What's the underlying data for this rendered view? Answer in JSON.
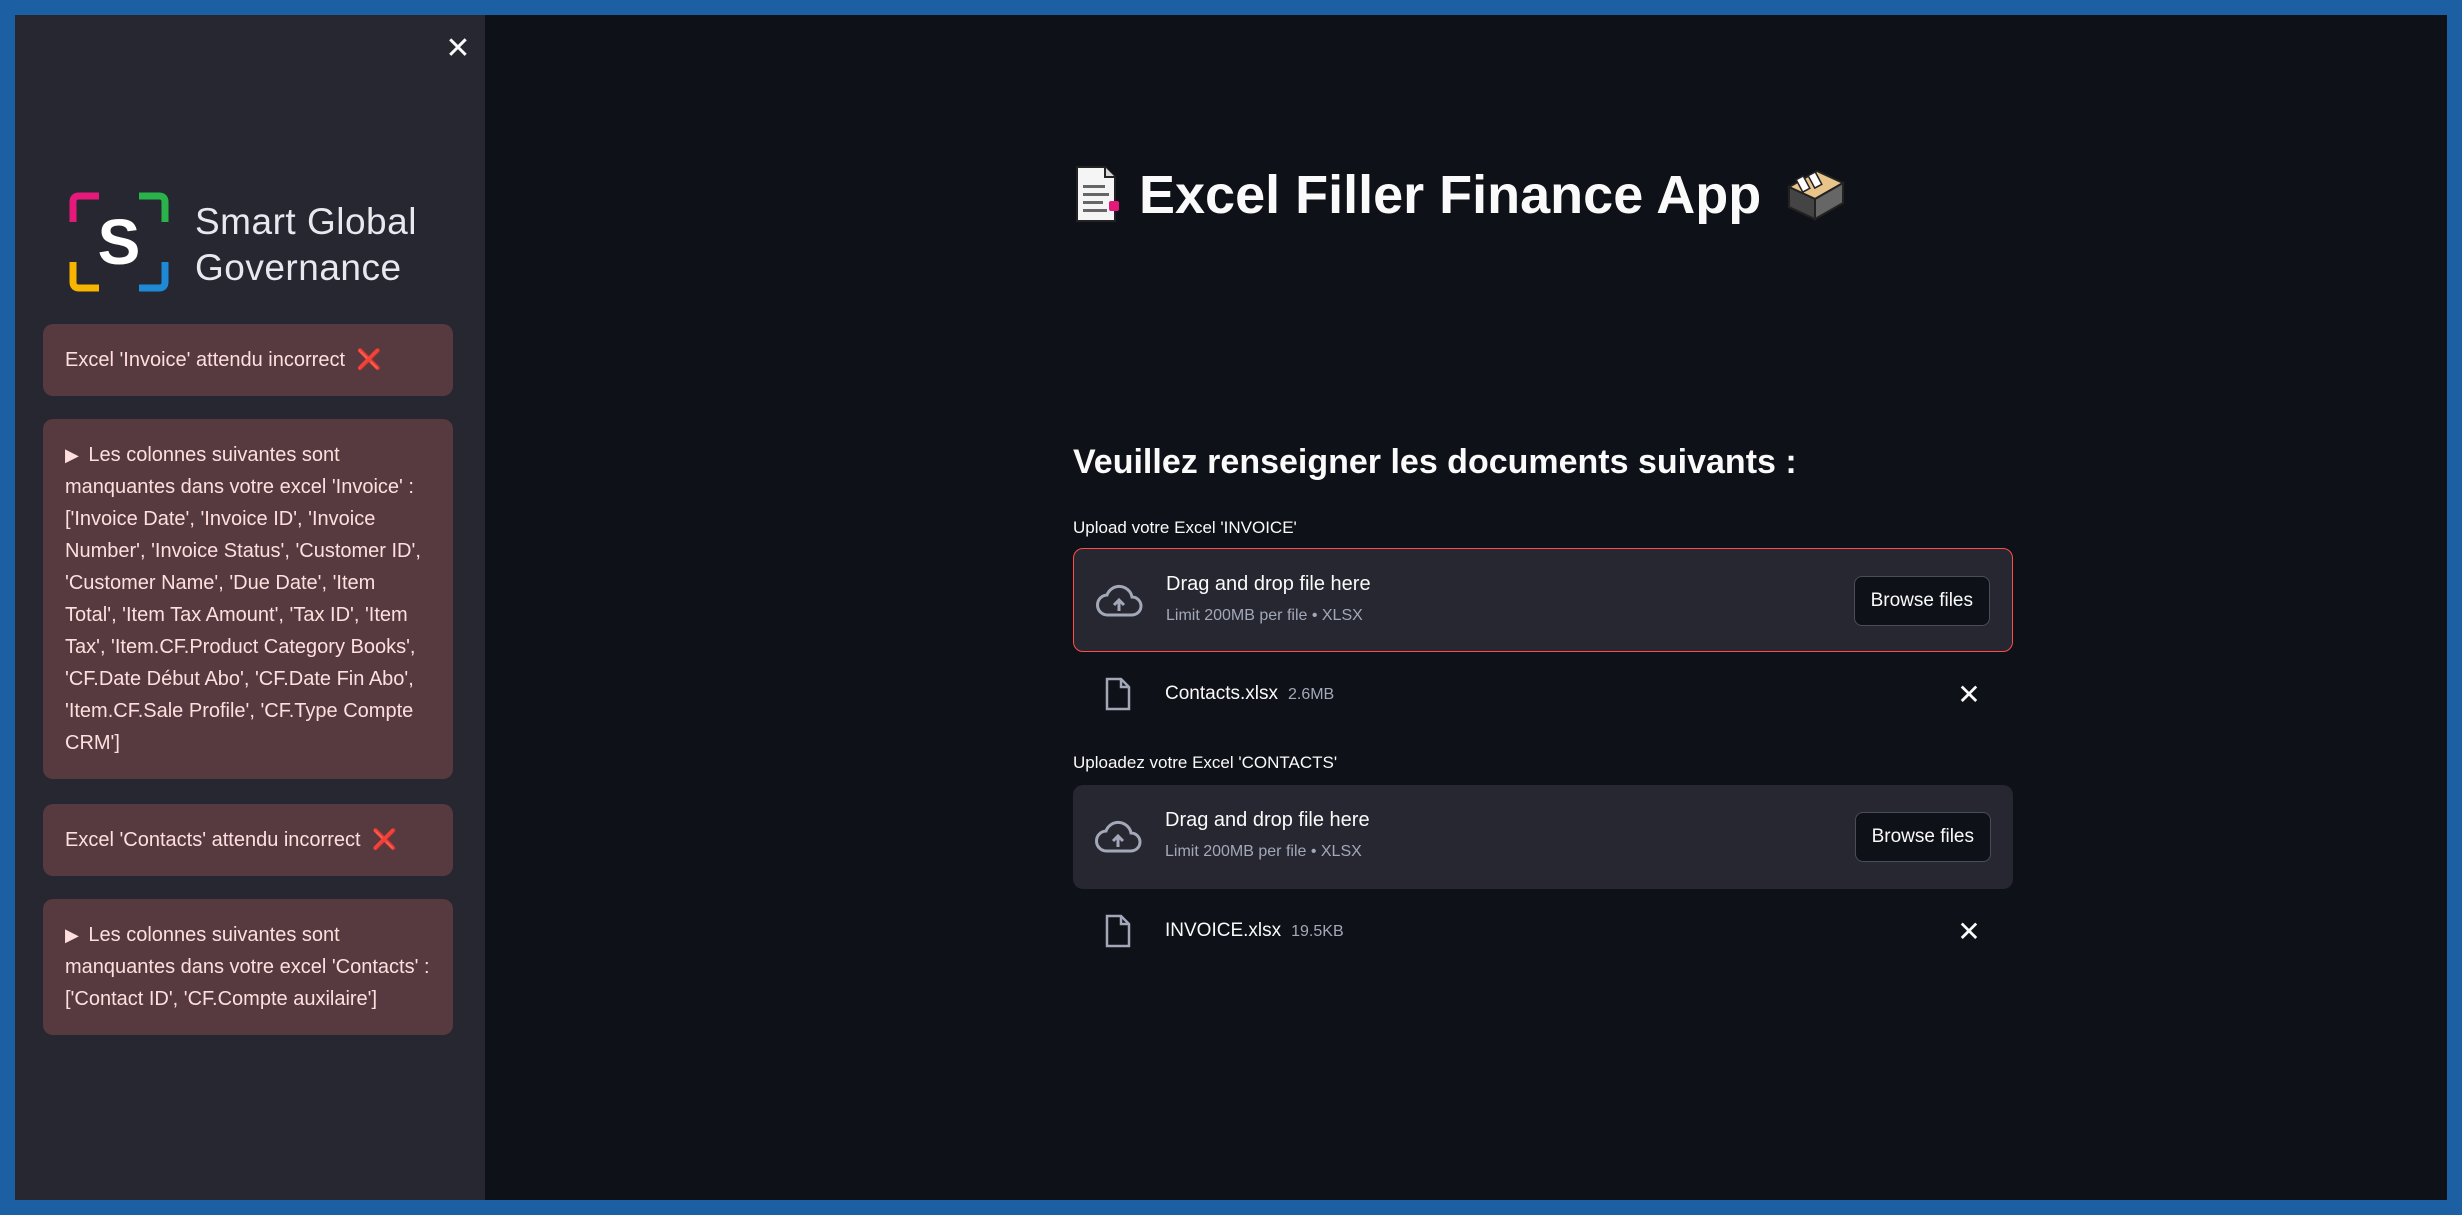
{
  "sidebar": {
    "close_icon": "close-icon",
    "logo": {
      "line1": "Smart Global",
      "line2": "Governance",
      "mark_letter": "S",
      "colors": [
        "#e5197a",
        "#2bb34b",
        "#f7b500",
        "#1e8ad6"
      ]
    },
    "alerts": [
      {
        "text": "Excel 'Invoice' attendu incorrect",
        "icon": "cross-mark-icon",
        "icon_glyph": "❌"
      },
      {
        "prefix": "▶",
        "text": "Les colonnes suivantes sont manquantes dans votre excel 'Invoice' : ['Invoice Date', 'Invoice ID', 'Invoice Number', 'Invoice Status', 'Customer ID', 'Customer Name', 'Due Date', 'Item Total', 'Item Tax Amount', 'Tax ID', 'Item Tax', 'Item.CF.Product Category Books', 'CF.Date Début Abo', 'CF.Date Fin Abo', 'Item.CF.Sale Profile', 'CF.Type Compte CRM']"
      },
      {
        "text": "Excel 'Contacts' attendu incorrect",
        "icon": "cross-mark-icon",
        "icon_glyph": "❌"
      },
      {
        "prefix": "▶",
        "text": "Les colonnes suivantes sont manquantes dans votre excel 'Contacts' : ['Contact ID', 'CF.Compte auxilaire']"
      }
    ]
  },
  "main": {
    "title": "Excel Filler Finance App",
    "title_icons": [
      "page-with-curl-icon",
      "card-file-box-icon"
    ],
    "heading": "Veuillez renseigner les documents suivants :",
    "uploaders": [
      {
        "label": "Upload votre Excel 'INVOICE'",
        "drop_text": "Drag and drop file here",
        "limit_text": "Limit 200MB per file • XLSX",
        "browse_label": "Browse files",
        "file": {
          "name": "Contacts.xlsx",
          "size": "2.6MB"
        },
        "state": "error"
      },
      {
        "label": "Uploadez votre Excel 'CONTACTS'",
        "drop_text": "Drag and drop file here",
        "limit_text": "Limit 200MB per file • XLSX",
        "browse_label": "Browse files",
        "file": {
          "name": "INVOICE.xlsx",
          "size": "19.5KB"
        },
        "state": "normal"
      }
    ]
  },
  "colors": {
    "background": "#0e1117",
    "sidebar": "#262730",
    "alert_bg": "#563a3f",
    "alert_text": "#ffdede",
    "error_border": "#ff4b4b",
    "frame": "#1c5fa3"
  }
}
